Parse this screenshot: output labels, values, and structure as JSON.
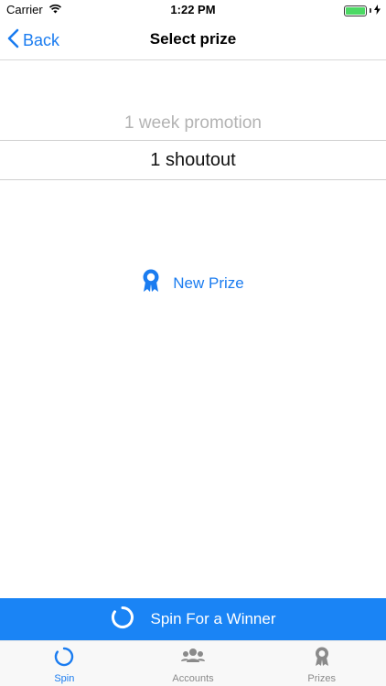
{
  "status_bar": {
    "carrier": "Carrier",
    "time": "1:22 PM"
  },
  "nav": {
    "back_label": "Back",
    "title": "Select prize"
  },
  "picker": {
    "options": [
      "1 week promotion",
      "1 shoutout"
    ],
    "selected_index": 1
  },
  "new_prize": {
    "label": "New Prize"
  },
  "spin": {
    "label": "Spin For a Winner"
  },
  "tabs": [
    {
      "label": "Spin",
      "icon": "spin-ring-icon",
      "active": true
    },
    {
      "label": "Accounts",
      "icon": "people-icon",
      "active": false
    },
    {
      "label": "Prizes",
      "icon": "award-ribbon-icon",
      "active": false
    }
  ],
  "colors": {
    "accent": "#1a7cf0",
    "spin_bar": "#1a84f5",
    "battery": "#4cd964"
  }
}
